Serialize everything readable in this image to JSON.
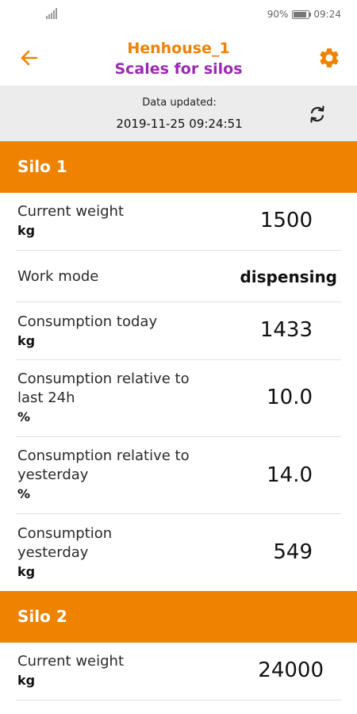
{
  "status_bar": {
    "battery": "90%",
    "time": "09:24"
  },
  "header": {
    "title": "Henhouse_1",
    "subtitle": "Scales for silos",
    "colors": {
      "title": "#ef8200",
      "subtitle": "#9b2ab2",
      "accent": "#ef8200"
    },
    "icons": {
      "back": "arrow-left-icon",
      "settings": "gear-icon"
    }
  },
  "update": {
    "label": "Data updated:",
    "datetime": "2019-11-25 09:24:51",
    "icon": "refresh-icon"
  },
  "silos": [
    {
      "name": "Silo 1",
      "rows": [
        {
          "label": "Current weight",
          "unit": "kg",
          "value": "1500"
        },
        {
          "label": "Work mode",
          "unit": "",
          "value": "dispensing"
        },
        {
          "label": "Consumption today",
          "unit": "kg",
          "value": "1433"
        },
        {
          "label": "Consumption relative to last 24h",
          "unit": "%",
          "value": "10.0"
        },
        {
          "label": "Consumption relative to yesterday",
          "unit": "%",
          "value": "14.0"
        },
        {
          "label": "Consumption yesterday",
          "unit": "kg",
          "value": "549"
        }
      ]
    },
    {
      "name": "Silo 2",
      "rows": [
        {
          "label": "Current weight",
          "unit": "kg",
          "value": "24000"
        }
      ]
    }
  ]
}
